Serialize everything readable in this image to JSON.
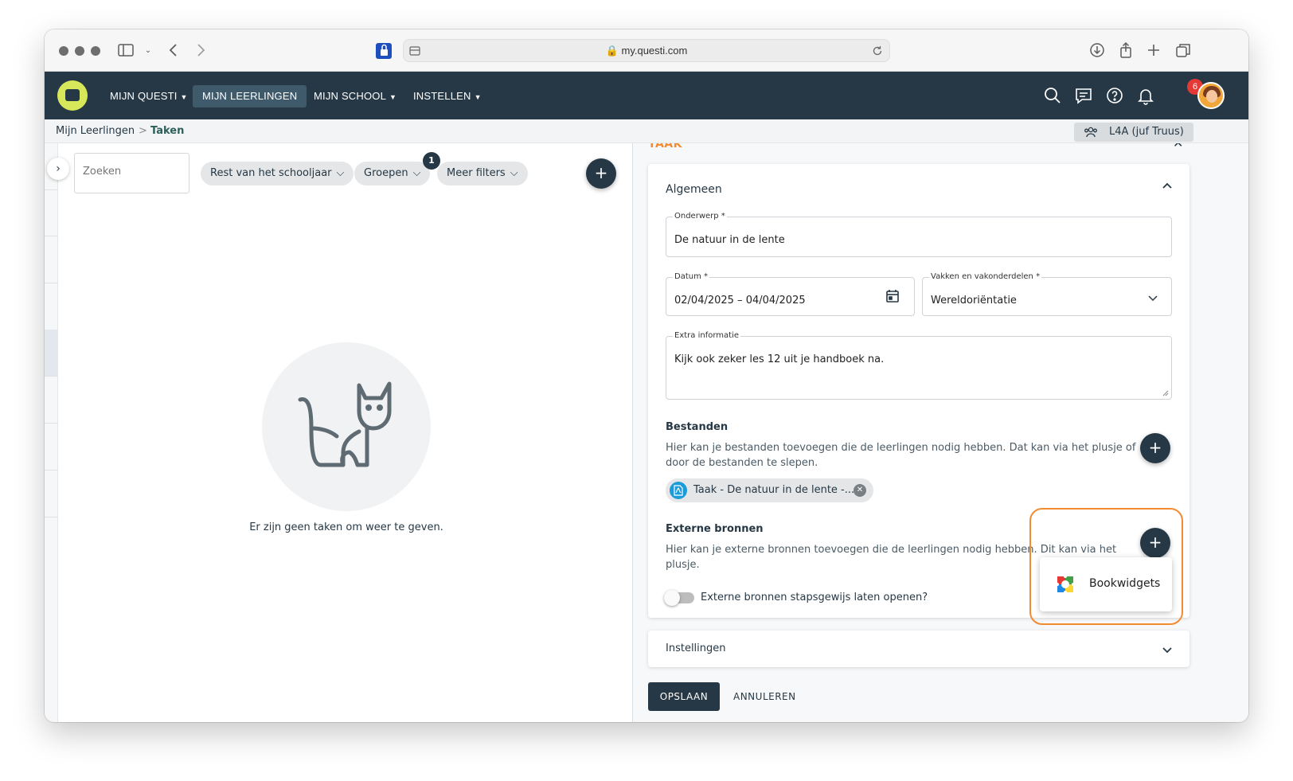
{
  "browser": {
    "url": "my.questi.com"
  },
  "nav": {
    "items": [
      {
        "label": "MIJN QUESTI"
      },
      {
        "label": "MIJN LEERLINGEN"
      },
      {
        "label": "MIJN SCHOOL"
      },
      {
        "label": "INSTELLEN"
      }
    ],
    "notification_count": "6"
  },
  "breadcrumb": {
    "parent": "Mijn Leerlingen",
    "separator": ">",
    "current": "Taken"
  },
  "group_selector": {
    "label": "L4A (juf Truus)"
  },
  "filters": {
    "search_placeholder": "Zoeken",
    "period": "Rest van het schooljaar",
    "groups": "Groepen",
    "groups_count": "1",
    "more": "Meer filters"
  },
  "empty_state": {
    "message": "Er zijn geen taken om weer te geven."
  },
  "form": {
    "heading": "TAAK",
    "general": {
      "title": "Algemeen",
      "subject_label": "Onderwerp *",
      "subject_value": "De natuur in de lente",
      "date_label": "Datum *",
      "date_value": "02/04/2025 – 04/04/2025",
      "course_label": "Vakken en vakonderdelen *",
      "course_value": "Wereldoriëntatie",
      "extra_label": "Extra informatie",
      "extra_value": "Kijk ook zeker les 12 uit je handboek na."
    },
    "files": {
      "title": "Bestanden",
      "description": "Hier kan je bestanden toevoegen die de leerlingen nodig hebben. Dat kan via het plusje of door de bestanden te slepen.",
      "file_name": "Taak - De natuur in de lente -..."
    },
    "external": {
      "title": "Externe bronnen",
      "description": "Hier kan je externe bronnen toevoegen die de leerlingen nodig hebben. Dit kan via het plusje.",
      "toggle_label": "Externe bronnen stapsgewijs laten openen?",
      "toggle_on": false,
      "menu_option": "Bookwidgets"
    },
    "settings": {
      "title": "Instellingen"
    },
    "save_label": "OPSLAAN",
    "cancel_label": "ANNULEREN"
  },
  "colors": {
    "nav_bg": "#263845",
    "accent": "#f28b30",
    "logo": "#d6e85a"
  }
}
